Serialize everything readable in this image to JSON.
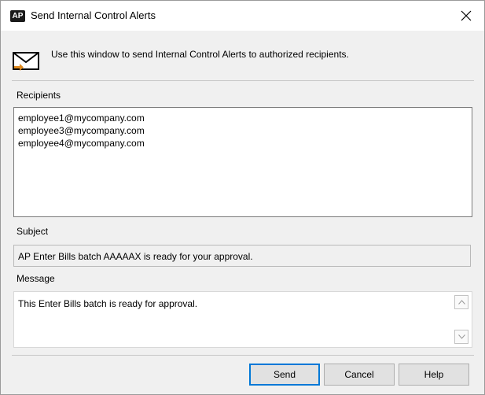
{
  "window": {
    "badge": "AP",
    "title": "Send Internal Control Alerts"
  },
  "intro": "Use this window to send Internal Control Alerts to authorized recipients.",
  "recipients": {
    "label": "Recipients",
    "items": [
      "employee1@mycompany.com",
      "employee3@mycompany.com",
      "employee4@mycompany.com"
    ]
  },
  "subject": {
    "label": "Subject",
    "value": "AP Enter Bills batch AAAAAX is ready for your approval."
  },
  "message": {
    "label": "Message",
    "value": "This Enter Bills batch is ready for approval."
  },
  "buttons": {
    "send": "Send",
    "cancel": "Cancel",
    "help": "Help"
  },
  "icons": {
    "close": "close-icon",
    "mail": "envelope-icon",
    "scroll_up": "chevron-up-icon",
    "scroll_down": "chevron-down-icon"
  },
  "colors": {
    "primary_button_border": "#0078d7",
    "mail_arrow": "#e08a1e"
  }
}
